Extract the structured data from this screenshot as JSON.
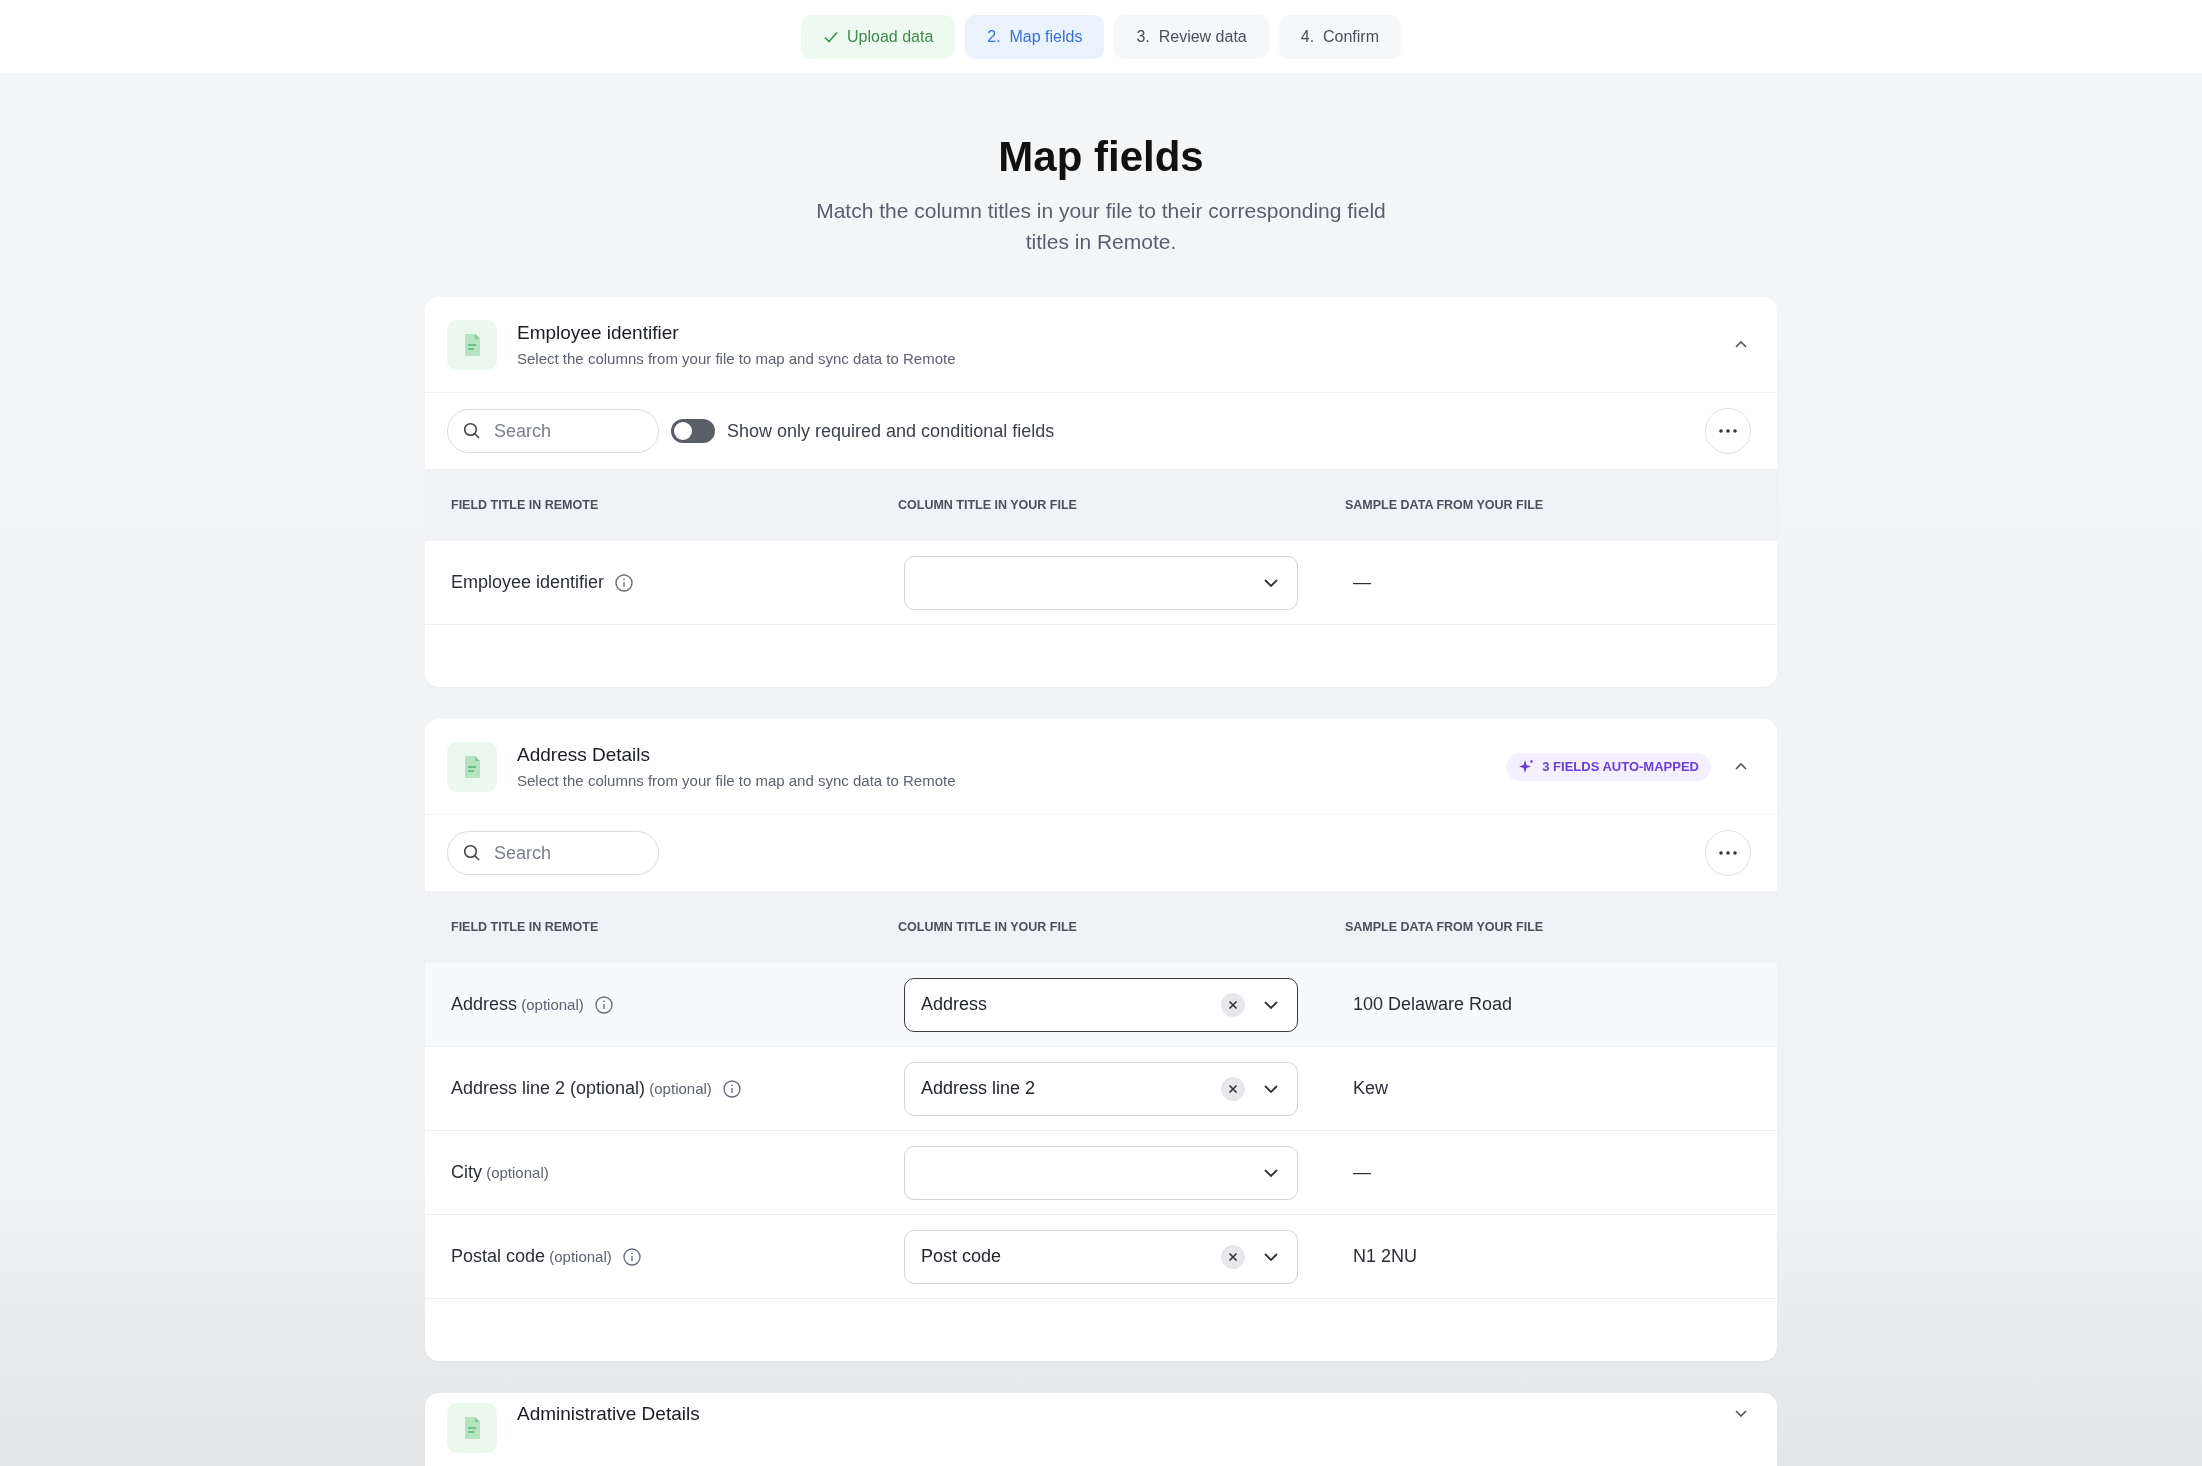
{
  "stepper": [
    {
      "label": "Upload data",
      "done": true,
      "selected": false
    },
    {
      "label": "2.  Map fields",
      "done": false,
      "selected": true
    },
    {
      "label": "3.  Review data",
      "done": false,
      "selected": false
    },
    {
      "label": "4.  Confirm",
      "done": false,
      "selected": false
    }
  ],
  "page": {
    "title": "Map fields",
    "subtitle": "Match the column titles in your file to their corresponding field titles in Remote."
  },
  "sections": [
    {
      "title": "Employee identifier",
      "description": "Select the columns from your file to map and sync data to Remote",
      "expanded": true,
      "search": {
        "placeholder": "Search"
      },
      "toggle": {
        "label": "Show only required and conditional fields",
        "on": false
      },
      "columns": [
        "FIELD TITLE IN REMOTE",
        "COLUMN TITLE IN YOUR FILE",
        "SAMPLE DATA FROM YOUR FILE"
      ],
      "rows": [
        {
          "field": "Employee identifier",
          "info": true,
          "focused": false,
          "sample": "—"
        }
      ]
    },
    {
      "title": "Address Details",
      "description": "Select the columns from your file to map and sync data to Remote",
      "expanded": true,
      "badge": "3 FIELDS AUTO-MAPPED",
      "search": {
        "placeholder": "Search"
      },
      "columns": [
        "FIELD TITLE IN REMOTE",
        "COLUMN TITLE IN YOUR FILE",
        "SAMPLE DATA FROM YOUR FILE"
      ],
      "rows": [
        {
          "field": "Address",
          "note": "(optional)",
          "info": true,
          "focused": true,
          "value": "Address",
          "sample": "100 Delaware Road"
        },
        {
          "field": "Address line 2 (optional)",
          "note": "(optional)",
          "info": true,
          "focused": false,
          "value": "Address line 2",
          "sample": "Kew"
        },
        {
          "field": "City",
          "note": "(optional)",
          "info": false,
          "focused": false,
          "sample": "—"
        },
        {
          "field": "Postal code",
          "note": "(optional)",
          "info": true,
          "focused": false,
          "value": "Post code",
          "sample": "N1 2NU"
        }
      ]
    },
    {
      "title": "Administrative Details",
      "expanded": false
    }
  ]
}
